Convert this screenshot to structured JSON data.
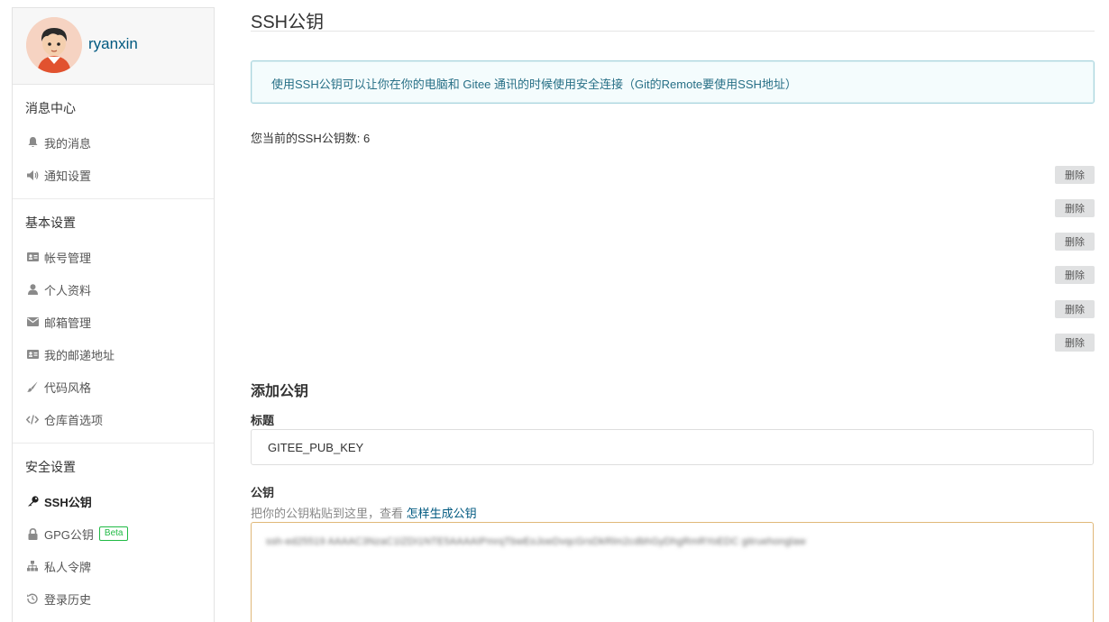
{
  "profile": {
    "username": "ryanxin"
  },
  "sidebar": {
    "sections": [
      {
        "title": "消息中心",
        "items": [
          {
            "label": "我的消息",
            "icon": "bell-icon"
          },
          {
            "label": "通知设置",
            "icon": "volume-icon"
          }
        ]
      },
      {
        "title": "基本设置",
        "items": [
          {
            "label": "帐号管理",
            "icon": "id-card-icon"
          },
          {
            "label": "个人资料",
            "icon": "user-icon"
          },
          {
            "label": "邮箱管理",
            "icon": "envelope-icon"
          },
          {
            "label": "我的邮递地址",
            "icon": "address-card-icon"
          },
          {
            "label": "代码风格",
            "icon": "brush-icon"
          },
          {
            "label": "仓库首选项",
            "icon": "code-icon"
          }
        ]
      },
      {
        "title": "安全设置",
        "items": [
          {
            "label": "SSH公钥",
            "icon": "key-icon",
            "active": true
          },
          {
            "label": "GPG公钥",
            "icon": "lock-icon",
            "badge": "Beta"
          },
          {
            "label": "私人令牌",
            "icon": "sitemap-icon"
          },
          {
            "label": "登录历史",
            "icon": "history-icon"
          }
        ]
      }
    ]
  },
  "main": {
    "title": "SSH公钥",
    "info": "使用SSH公钥可以让你在你的电脑和 Gitee 通讯的时候使用安全连接（Git的Remote要使用SSH地址）",
    "count_label": "您当前的SSH公钥数: 6",
    "delete_label": "删除",
    "delete_count": 6,
    "add_title": "添加公钥",
    "title_label": "标题",
    "title_value": "GITEE_PUB_KEY",
    "key_label": "公钥",
    "key_hint": "把你的公钥粘贴到这里，查看 ",
    "key_hint_link": "怎样生成公钥"
  },
  "colors": {
    "accent": "#005980",
    "info_bg": "#f4fcfd",
    "info_border": "#a9d5de",
    "beta": "#21ba45",
    "textarea_border": "#e0b879"
  }
}
